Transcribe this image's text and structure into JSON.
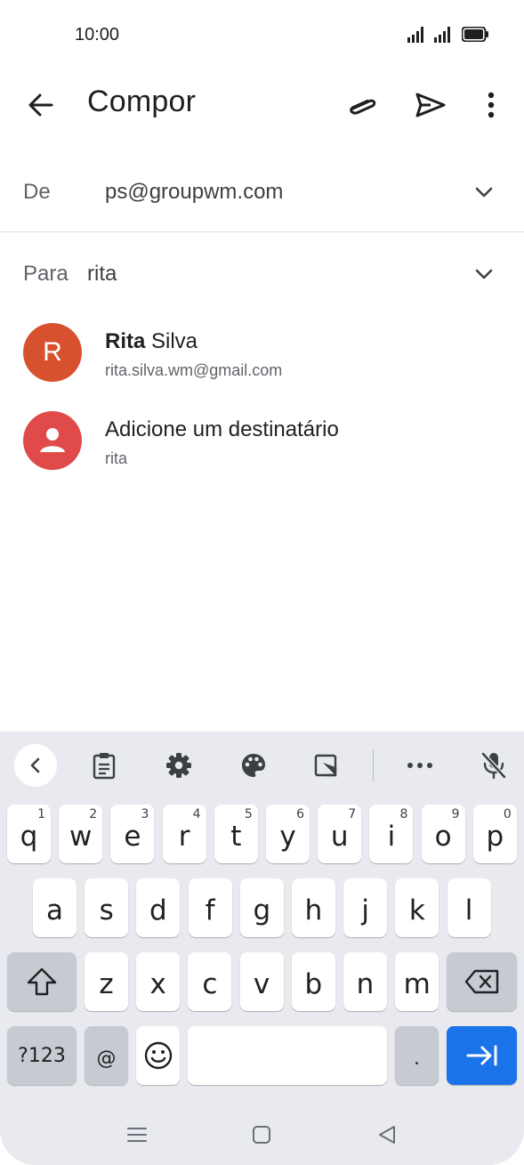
{
  "status_bar": {
    "time": "10:00"
  },
  "app_bar": {
    "title": "Compor",
    "icons": [
      "back-arrow-icon",
      "paperclip-icon",
      "send-icon",
      "more-vert-icon"
    ]
  },
  "from": {
    "label": "De",
    "value": "ps@groupwm.com"
  },
  "to": {
    "label": "Para",
    "value": "rita"
  },
  "suggestions": [
    {
      "avatar_letter": "R",
      "name_bold": "Rita",
      "name_rest": " Silva",
      "email": "rita.silva.wm@gmail.com"
    },
    {
      "name": "Adicione um destinatário",
      "sub": "rita"
    }
  ],
  "keyboard": {
    "row1": [
      {
        "k": "q",
        "h": "1"
      },
      {
        "k": "w",
        "h": "2"
      },
      {
        "k": "e",
        "h": "3"
      },
      {
        "k": "r",
        "h": "4"
      },
      {
        "k": "t",
        "h": "5"
      },
      {
        "k": "y",
        "h": "6"
      },
      {
        "k": "u",
        "h": "7"
      },
      {
        "k": "i",
        "h": "8"
      },
      {
        "k": "o",
        "h": "9"
      },
      {
        "k": "p",
        "h": "0"
      }
    ],
    "row2": [
      "a",
      "s",
      "d",
      "f",
      "g",
      "h",
      "j",
      "k",
      "l"
    ],
    "row3": [
      "z",
      "x",
      "c",
      "v",
      "b",
      "n",
      "m"
    ],
    "symbols_label": "?123",
    "at_label": "@",
    "period_label": "."
  },
  "colors": {
    "accent_blue": "#1a73e8",
    "avatar_rita": "#d8512f",
    "avatar_add": "#e04a4a",
    "keyboard_bg": "#e8eaef"
  }
}
